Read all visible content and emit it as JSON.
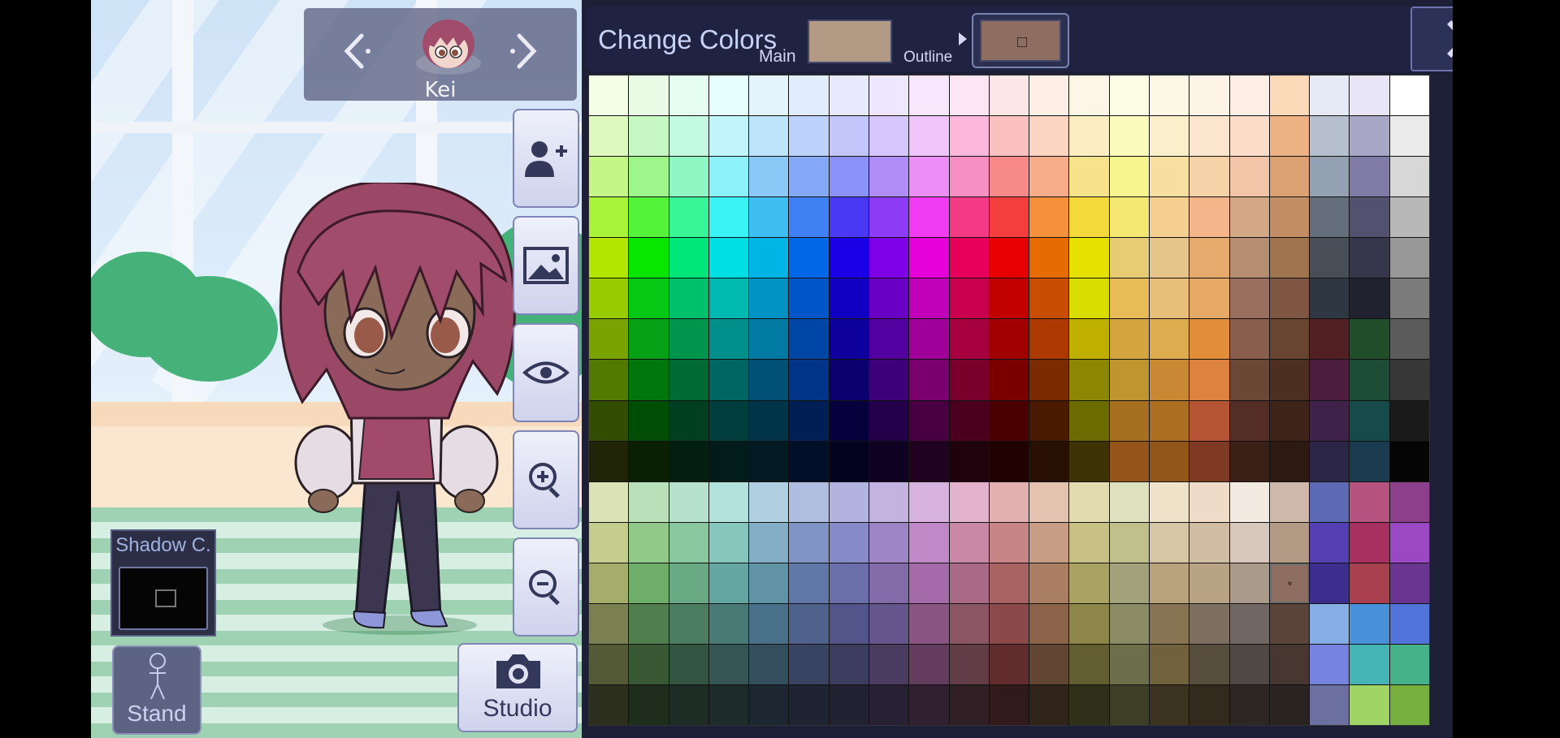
{
  "character": {
    "name": "Kei"
  },
  "left_tools": [
    {
      "name": "add-character-button",
      "icon": "add-user-icon"
    },
    {
      "name": "background-button",
      "icon": "image-icon"
    },
    {
      "name": "visibility-button",
      "icon": "eye-icon"
    },
    {
      "name": "zoom-in-button",
      "icon": "zoom-in-icon"
    },
    {
      "name": "zoom-out-button",
      "icon": "zoom-out-icon"
    }
  ],
  "studio": {
    "label": "Studio",
    "icon": "camera-icon"
  },
  "stand": {
    "label": "Stand",
    "icon": "pose-figure-icon"
  },
  "shadow": {
    "label": "Shadow C.",
    "color": "#050505"
  },
  "panel": {
    "title": "Change Colors",
    "main_label": "Main",
    "outline_label": "Outline",
    "main_color": "#b39a85",
    "outline_color": "#8e6e61",
    "close_label": "X"
  },
  "palette": {
    "selected": [
      12,
      17
    ],
    "rows": [
      [
        "#f4fde6",
        "#eafbe6",
        "#e6fdf1",
        "#e7feff",
        "#e3f4fd",
        "#e1ecfc",
        "#e8e9fd",
        "#efe7fd",
        "#f8e6fd",
        "#fde6f3",
        "#fde6e6",
        "#fdeee6",
        "#fdf6e6",
        "#fdfde6",
        "#fdf8e6",
        "#fdf3e6",
        "#fdefe6",
        "#fcd9b8",
        "#e6eaf6",
        "#e8e6f6",
        "#ffffff"
      ],
      [
        "#def8be",
        "#c7f7c2",
        "#c2f9e1",
        "#c0f6fb",
        "#bde4fb",
        "#bcd2fb",
        "#c3c6fb",
        "#d5c6fb",
        "#efc4fb",
        "#fbb8dc",
        "#fbc1c1",
        "#fbd5c1",
        "#fbeec1",
        "#fbfbbe",
        "#fbefcb",
        "#fbe5cf",
        "#fbdcc8",
        "#eeb182",
        "#b5bfcd",
        "#a9a7c7",
        "#ebebeb"
      ],
      [
        "#c4f586",
        "#9ef58a",
        "#8ff6c4",
        "#8cf1f9",
        "#8ac8f7",
        "#86a9f7",
        "#8a92f7",
        "#b08cf7",
        "#eb8ff7",
        "#f78fc4",
        "#f78989",
        "#f7ad8a",
        "#f7e48a",
        "#f7f58d",
        "#f6dfa0",
        "#f5d2a8",
        "#f2c5a8",
        "#dca173",
        "#93a1b2",
        "#7f7aa6",
        "#d7d7d7"
      ],
      [
        "#a8f33a",
        "#55f23a",
        "#38f596",
        "#3af3f4",
        "#3fbef4",
        "#3f80f4",
        "#4a39f4",
        "#8d3bf4",
        "#f03bf2",
        "#f43a86",
        "#f43d3d",
        "#f4913a",
        "#f4d93a",
        "#f4e873",
        "#f4cf90",
        "#f4b58a",
        "#d3a985",
        "#c38d66",
        "#646e7b",
        "#525270",
        "#b8b8b8"
      ],
      [
        "#b2e600",
        "#08e600",
        "#00e67b",
        "#00e0e4",
        "#00b4e6",
        "#0068e6",
        "#1a00e6",
        "#7d00e6",
        "#e600d9",
        "#e6005b",
        "#e60000",
        "#e66b00",
        "#e6e100",
        "#e8cc73",
        "#e6c58a",
        "#e6aa6d",
        "#b58d71",
        "#a0744f",
        "#474e58",
        "#35364b",
        "#989898"
      ],
      [
        "#99cc00",
        "#05c814",
        "#00c16b",
        "#00b9b1",
        "#0093c3",
        "#0055c8",
        "#1100c1",
        "#6a00c3",
        "#c100b9",
        "#c8004d",
        "#c30000",
        "#c94e04",
        "#dadd00",
        "#e7bc58",
        "#e9be78",
        "#e7a966",
        "#9a6f60",
        "#7f5641",
        "#2f3743",
        "#21222f",
        "#7b7b7b"
      ],
      [
        "#7aa300",
        "#06a016",
        "#00954d",
        "#008f8b",
        "#007aa3",
        "#0046a6",
        "#0e009c",
        "#5300a1",
        "#a0009a",
        "#a7003e",
        "#a00000",
        "#ad3800",
        "#bfb000",
        "#d4a53f",
        "#dcac4e",
        "#e18d3a",
        "#8a5e4c",
        "#674530",
        "#521f22",
        "#204d2a",
        "#5b5b5b"
      ],
      [
        "#527a00",
        "#00760c",
        "#006a35",
        "#006663",
        "#005175",
        "#003488",
        "#0a006e",
        "#3d0079",
        "#7a0070",
        "#7a002c",
        "#7a0000",
        "#7a2c00",
        "#8c8600",
        "#bf9530",
        "#c98834",
        "#dd8340",
        "#6b4736",
        "#4d2f22",
        "#4c1d3e",
        "#1d4c35",
        "#373737"
      ],
      [
        "#334d00",
        "#004d06",
        "#004021",
        "#003d3d",
        "#003448",
        "#001f55",
        "#06003d",
        "#25004a",
        "#480042",
        "#4a001c",
        "#4a0000",
        "#4a1a00",
        "#6b6b00",
        "#a76f20",
        "#aa6f20",
        "#b55533",
        "#532d26",
        "#3e2318",
        "#3e2249",
        "#174b4a",
        "#1a1a1a"
      ],
      [
        "#1f2506",
        "#0b2003",
        "#031f11",
        "#021b1b",
        "#031a23",
        "#020f28",
        "#03021f",
        "#0f0223",
        "#200220",
        "#20020c",
        "#200202",
        "#281102",
        "#3e3304",
        "#955419",
        "#935619",
        "#7f3a23",
        "#3a2015",
        "#2c1a12",
        "#2b2548",
        "#1b3c50",
        "#050505"
      ],
      [
        "#dbe2b6",
        "#b9e0b8",
        "#b6e1cb",
        "#b3e2dd",
        "#b0d0e1",
        "#aebde0",
        "#b3b3df",
        "#c4b2e0",
        "#d7b2df",
        "#e3b2cc",
        "#e3b0b0",
        "#e3c3b0",
        "#e3dbb0",
        "#dfe0be",
        "#eee3c9",
        "#efdcc8",
        "#f3ebe2",
        "#cfb8a9",
        "#5c69b4",
        "#b5527f",
        "#8e3f8b"
      ],
      [
        "#c4cc8e",
        "#92c98a",
        "#89c79f",
        "#86c6bd",
        "#83aec6",
        "#8095c6",
        "#868ac6",
        "#9e86c6",
        "#c188c8",
        "#c888a6",
        "#c88585",
        "#c89d85",
        "#c8c185",
        "#c0c08d",
        "#d7c6a6",
        "#d0bda4",
        "#d8c8bb",
        "#b39a85",
        "#543fb3",
        "#a73060",
        "#9a48c4"
      ],
      [
        "#a5ad6b",
        "#6fae6a",
        "#69aa84",
        "#64a7a2",
        "#6093a6",
        "#5f78a8",
        "#6a6ea9",
        "#836aa9",
        "#a56aa9",
        "#a96a85",
        "#a96363",
        "#a97e63",
        "#a9a363",
        "#a1a27a",
        "#b9a37d",
        "#b8a485",
        "#a99a8a",
        "#8e6e61",
        "#3d2e8e",
        "#a8404f",
        "#6a3591"
      ],
      [
        "#7a8051",
        "#517e4e",
        "#4c7d61",
        "#4a7a76",
        "#487089",
        "#4e628b",
        "#535489",
        "#64558c",
        "#8a5582",
        "#8c5563",
        "#8c4949",
        "#8a6349",
        "#8c8649",
        "#8b8c66",
        "#867453",
        "#7d7060",
        "#706762",
        "#5a4339",
        "#85aee6",
        "#4990da",
        "#5074d9"
      ],
      [
        "#545a35",
        "#385934",
        "#335643",
        "#355654",
        "#344d5f",
        "#384462",
        "#3c3c5f",
        "#4a3c61",
        "#643c5e",
        "#623c47",
        "#622c2c",
        "#624532",
        "#625e32",
        "#6d6e4a",
        "#71613d",
        "#574e3e",
        "#504844",
        "#483731",
        "#7683e0",
        "#45b4b4",
        "#46b28a"
      ],
      [
        "#2c2f1d",
        "#1f2e1c",
        "#1d2d25",
        "#1d2c2b",
        "#1d2731",
        "#1f2432",
        "#222232",
        "#272133",
        "#302032",
        "#301f25",
        "#301a1a",
        "#30231a",
        "#30301a",
        "#3e3d25",
        "#3c3220",
        "#34291d",
        "#2e2622",
        "#2b2320",
        "#6b70a1",
        "#9fd565",
        "#78b040"
      ]
    ]
  }
}
